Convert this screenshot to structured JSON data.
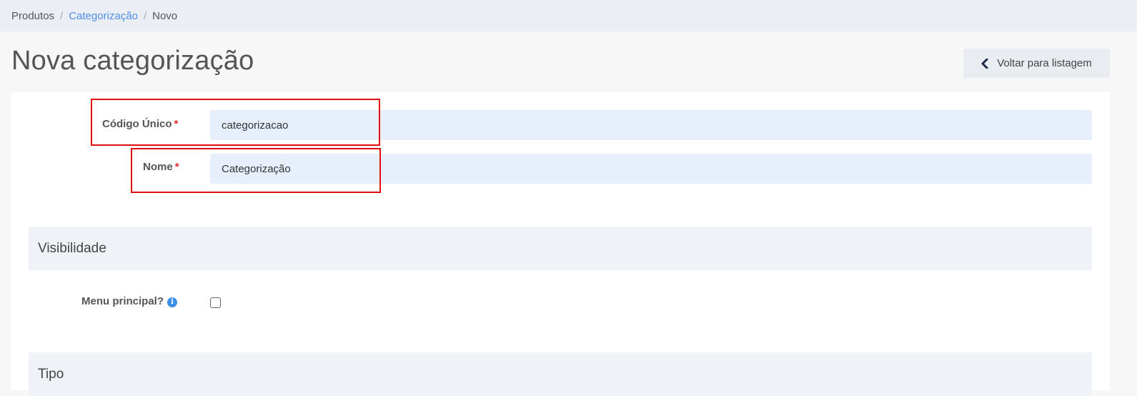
{
  "breadcrumb": {
    "items": [
      "Produtos",
      "Categorização",
      "Novo"
    ],
    "separator": "/"
  },
  "page": {
    "title": "Nova categorização",
    "back_button_label": "Voltar para listagem"
  },
  "form": {
    "codigo_unico": {
      "label": "Código Único",
      "required_mark": "*",
      "value": "categorizacao"
    },
    "nome": {
      "label": "Nome",
      "required_mark": "*",
      "value": "Categorização"
    }
  },
  "sections": {
    "visibilidade": {
      "title": "Visibilidade",
      "menu_principal": {
        "label": "Menu principal?",
        "info_icon": "i",
        "checked": false
      }
    },
    "tipo": {
      "title": "Tipo"
    }
  },
  "colors": {
    "accent_link": "#4d8fe6",
    "required": "#e02b2b",
    "highlight_border": "#e01010",
    "input_bg": "#e8effc"
  }
}
